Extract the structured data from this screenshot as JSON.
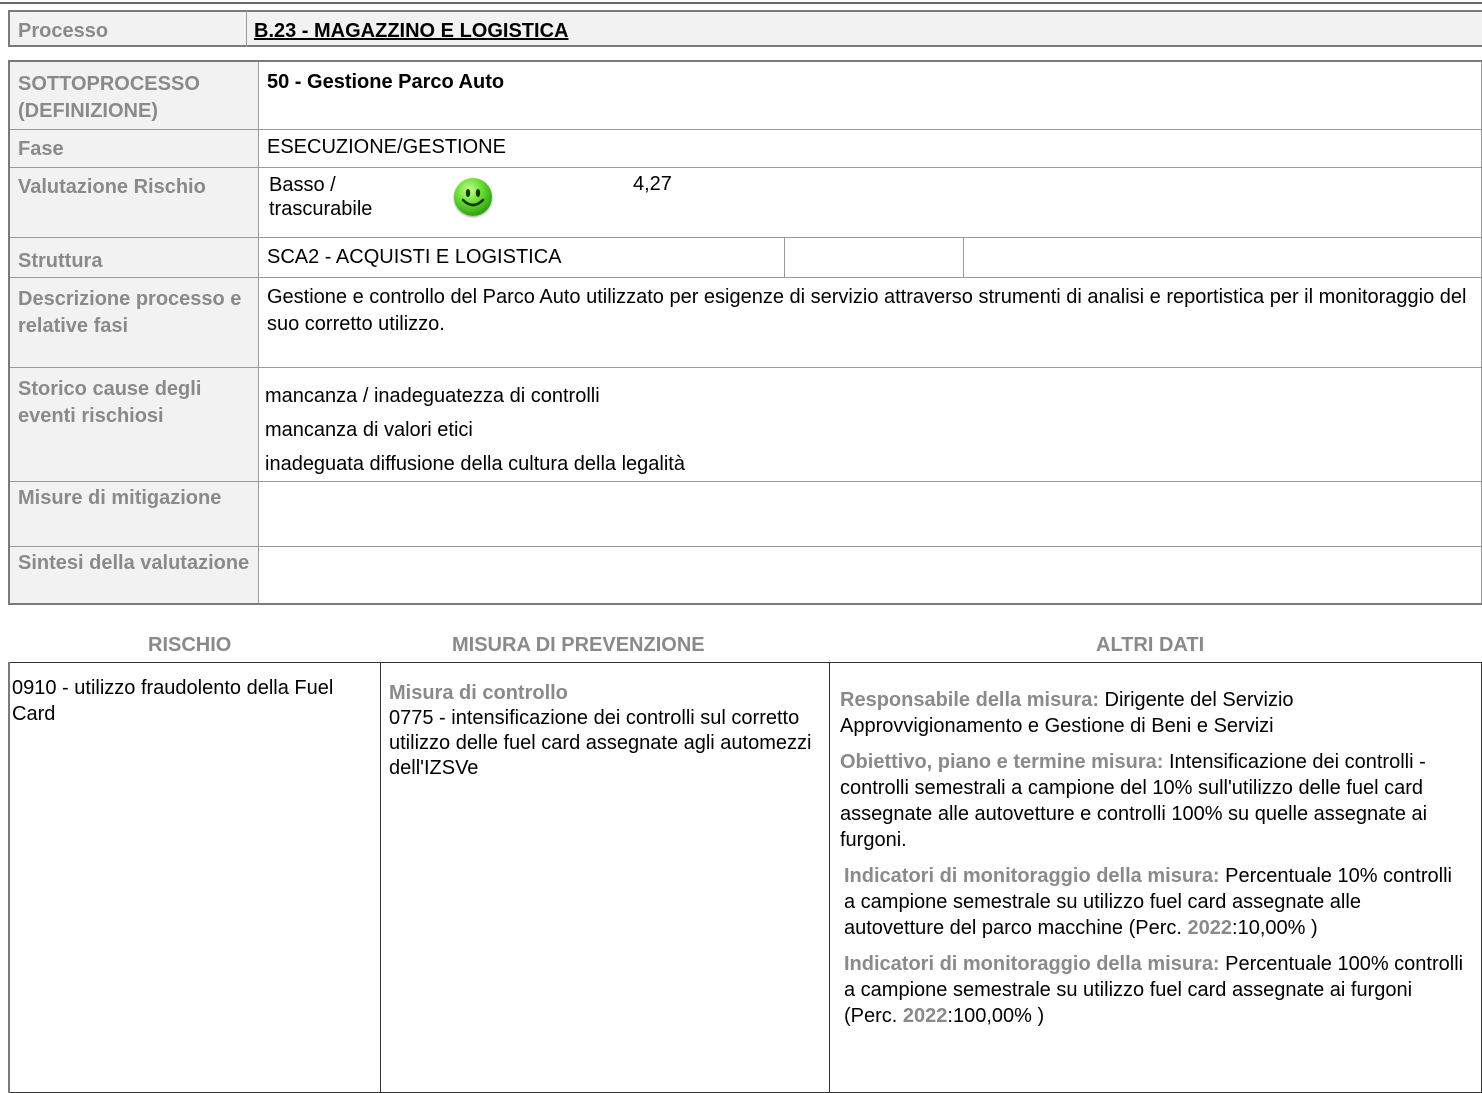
{
  "process": {
    "label": "Processo",
    "value": "B.23 - MAGAZZINO E LOGISTICA"
  },
  "rows": {
    "sottoprocesso": {
      "label": "SOTTOPROCESSO (DEFINIZIONE)",
      "value": "50 - Gestione Parco Auto"
    },
    "fase": {
      "label": "Fase",
      "value": "ESECUZIONE/GESTIONE"
    },
    "valutazione": {
      "label": "Valutazione Rischio",
      "level": "Basso / trascurabile",
      "score": "4,27",
      "icon": "smiley-green-icon"
    },
    "struttura": {
      "label": "Struttura",
      "value": "SCA2 - ACQUISTI E LOGISTICA"
    },
    "descrizione": {
      "label": "Descrizione processo e relative fasi",
      "value": "Gestione e controllo del Parco Auto utilizzato per esigenze di servizio attraverso strumenti di analisi e reportistica per il monitoraggio del suo corretto utilizzo."
    },
    "storico": {
      "label": "Storico cause degli eventi rischiosi",
      "items": [
        "mancanza / inadeguatezza di controlli",
        "mancanza di valori etici",
        "inadeguata diffusione della cultura della legalità"
      ]
    },
    "misure": {
      "label": "Misure di mitigazione",
      "value": ""
    },
    "sintesi": {
      "label": "Sintesi della valutazione",
      "value": ""
    }
  },
  "headers": {
    "rischio": "RISCHIO",
    "misura": "MISURA DI PREVENZIONE",
    "altri": "ALTRI DATI"
  },
  "detail": {
    "rischio": "0910 - utilizzo fraudolento della Fuel Card",
    "misura_tipo": "Misura di controllo",
    "misura_testo": "0775 - intensificazione dei controlli sul corretto utilizzo  delle fuel card assegnate agli automezzi dell'IZSVe",
    "responsabile_label": "Responsabile della misura:",
    "responsabile": "Dirigente del Servizio Approvvigionamento e Gestione di Beni e Servizi",
    "obiettivo_label": "Obiettivo, piano e termine misura:",
    "obiettivo": "Intensificazione dei controlli - controlli semestrali a campione del 10% sull'utilizzo delle fuel card assegnate alle autovetture e controlli 100% su quelle assegnate ai furgoni.",
    "indicatori": [
      {
        "label": "Indicatori di monitoraggio della misura:",
        "text": "Percentuale 10% controlli a campione semestrale su utilizzo fuel card assegnate alle autovetture del parco macchine (Perc.",
        "year": "2022",
        "value": ":10,00%  )"
      },
      {
        "label": "Indicatori di monitoraggio della misura:",
        "text": "Percentuale 100% controlli a campione semestrale su utilizzo fuel card assegnate ai furgoni (Perc.",
        "year": "2022",
        "value": ":100,00%  )"
      }
    ]
  }
}
